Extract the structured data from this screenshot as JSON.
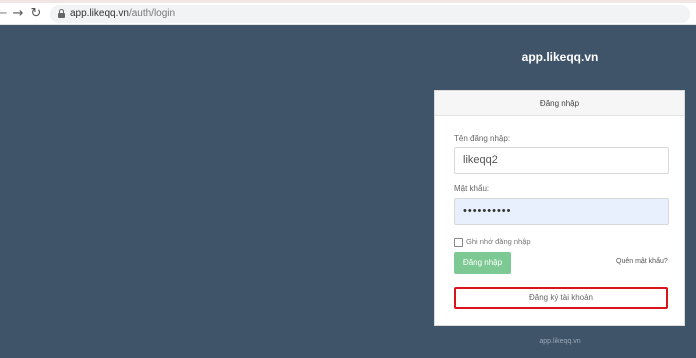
{
  "browser": {
    "url_host": "app.likeqq.vn",
    "url_path": "/auth/login"
  },
  "app": {
    "title": "app.likeqq.vn"
  },
  "login": {
    "header": "Đăng nhập",
    "username_label": "Tên đăng nhập:",
    "username_value": "likeqq2",
    "password_label": "Mật khẩu:",
    "password_value": "••••••••••",
    "remember_label": "Ghi nhớ đăng nhập",
    "remember_checked": false,
    "login_button": "Đăng nhập",
    "forgot_link": "Quên mật khẩu?",
    "register_button": "Đăng ký tài khoản"
  },
  "footer": {
    "text": "app.likeqq.vn"
  },
  "colors": {
    "background": "#3f5369",
    "login_button": "#7dc993",
    "register_highlight": "#d9141c",
    "password_field": "#e8f0fe"
  },
  "icons": [
    "back-arrow-icon",
    "forward-arrow-icon",
    "reload-icon",
    "lock-icon",
    "checkbox-icon"
  ]
}
